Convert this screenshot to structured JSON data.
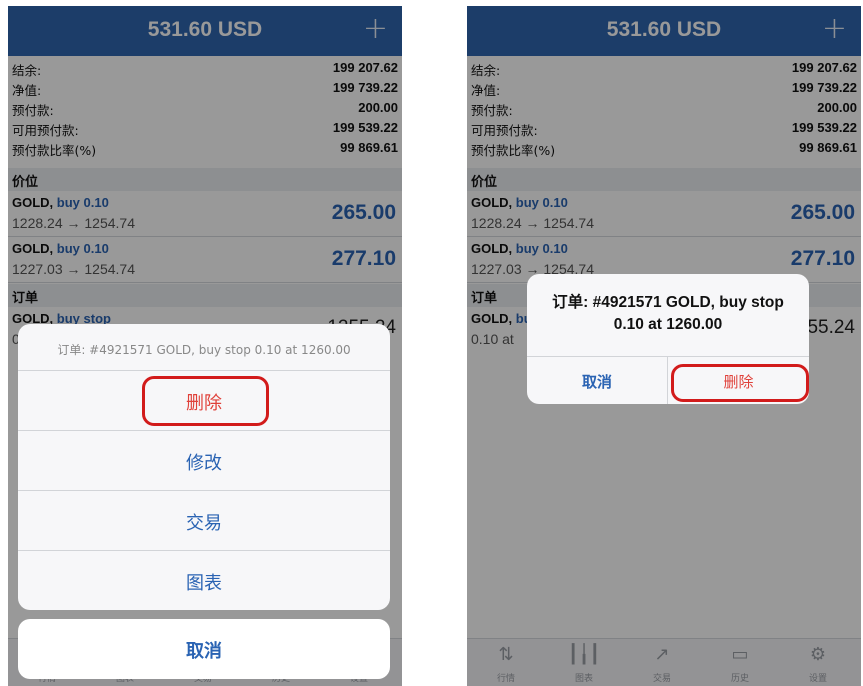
{
  "header": {
    "balance_title": "531.60 USD",
    "plus_icon": "+"
  },
  "summary": [
    {
      "label": "结余:",
      "value": "199 207.62"
    },
    {
      "label": "净值:",
      "value": "199 739.22"
    },
    {
      "label": "预付款:",
      "value": "200.00"
    },
    {
      "label": "可用预付款:",
      "value": "199 539.22"
    },
    {
      "label": "预付款比率(%)",
      "value": "99 869.61"
    }
  ],
  "positions_section": "价位",
  "positions": [
    {
      "symbol": "GOLD,",
      "side": "buy 0.10",
      "prices": "1228.24 → 1254.74",
      "profit": "265.00"
    },
    {
      "symbol": "GOLD,",
      "side": "buy 0.10",
      "prices": "1227.03 → 1254.74",
      "profit": "277.10"
    }
  ],
  "orders_section": "订单",
  "order": {
    "symbol": "GOLD,",
    "side": "buy stop",
    "volume": "0.10 at",
    "current_price": "1255.24"
  },
  "action_sheet": {
    "title": "订单: #4921571 GOLD, buy stop 0.10 at 1260.00",
    "options": [
      "删除",
      "修改",
      "交易",
      "图表"
    ],
    "cancel": "取消"
  },
  "alert": {
    "message": "订单: #4921571 GOLD, buy stop 0.10 at 1260.00",
    "cancel": "取消",
    "delete": "删除"
  },
  "tabbar": [
    {
      "label": "行情",
      "icon": "quotes-icon"
    },
    {
      "label": "图表",
      "icon": "chart-icon"
    },
    {
      "label": "交易",
      "icon": "trade-icon"
    },
    {
      "label": "历史",
      "icon": "history-icon"
    },
    {
      "label": "设置",
      "icon": "settings-icon"
    }
  ],
  "colors": {
    "header": "#2f66b0",
    "accent_blue": "#2a63b3",
    "delete_red": "#e0413a",
    "highlight_ring": "#d21b1b"
  }
}
